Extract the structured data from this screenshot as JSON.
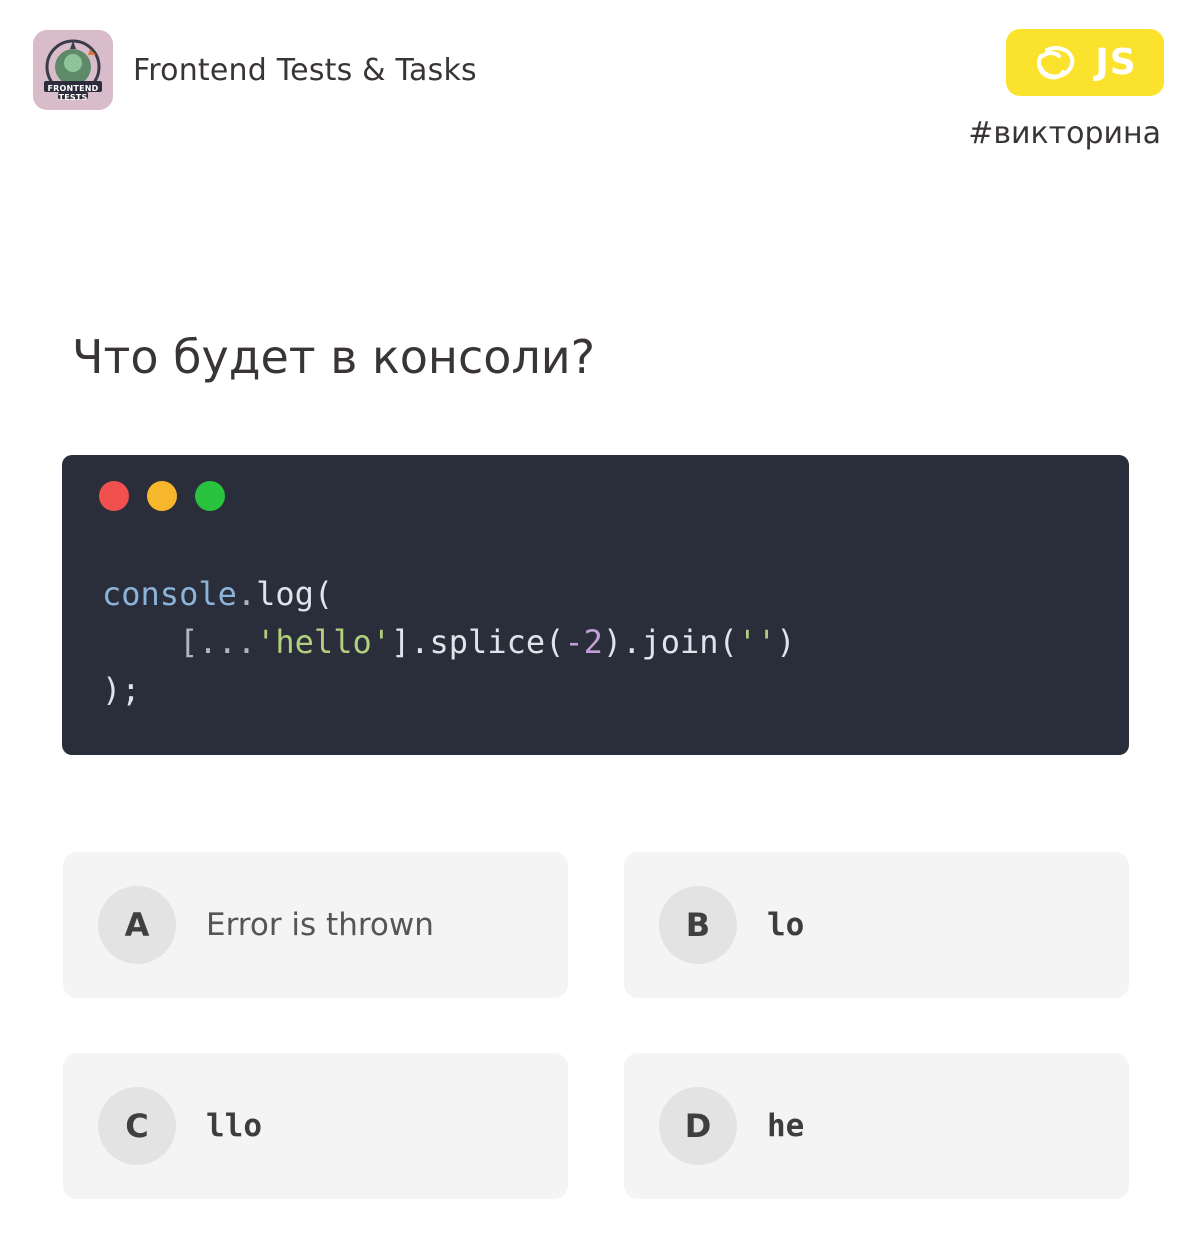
{
  "header": {
    "logo_text": "FRONTEND TESTS",
    "title": "Frontend Tests & Tasks"
  },
  "badge": {
    "label": "JS",
    "color": "#fbe32d",
    "icon": "chat-bubbles-icon"
  },
  "hashtag": "#викторина",
  "question": "Что будет в консоли?",
  "code_window": {
    "background": "#2a2e3a",
    "dots": [
      "#f2504e",
      "#f7b72d",
      "#28c23f"
    ],
    "code": {
      "l1_obj": "console",
      "l1_dot": ".",
      "l1_fn": "log(",
      "l2_indent": "    ",
      "l2_open": "[...",
      "l2_str": "'hello'",
      "l2_mid": "].splice(",
      "l2_num": "-2",
      "l2_mid2": ").join(",
      "l2_str2": "''",
      "l2_close": ")",
      "l3": ");"
    }
  },
  "options": [
    {
      "letter": "A",
      "text": "Error is thrown"
    },
    {
      "letter": "B",
      "text": "lo"
    },
    {
      "letter": "C",
      "text": "llo"
    },
    {
      "letter": "D",
      "text": "he"
    }
  ]
}
